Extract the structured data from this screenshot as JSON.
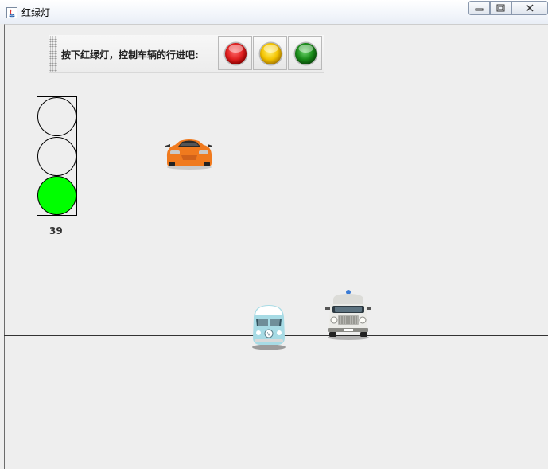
{
  "window": {
    "title": "红绿灯",
    "blurred_titles": [
      "",
      "",
      ""
    ]
  },
  "toolbar": {
    "prompt": "按下红绿灯，控制车辆的行进吧:",
    "buttons": [
      {
        "name": "red-light-button",
        "color": "#e02020"
      },
      {
        "name": "yellow-light-button",
        "color": "#f4c400"
      },
      {
        "name": "green-light-button",
        "color": "#1a8c1a"
      }
    ]
  },
  "traffic_light": {
    "active": "green",
    "active_color": "#00ff00",
    "countdown": "39"
  },
  "vehicles": [
    {
      "name": "orange-sports-car",
      "color": "#f07a1e"
    },
    {
      "name": "blue-vw-van",
      "color": "#9cd3df"
    },
    {
      "name": "white-truck",
      "color": "#e8e8e4"
    }
  ]
}
